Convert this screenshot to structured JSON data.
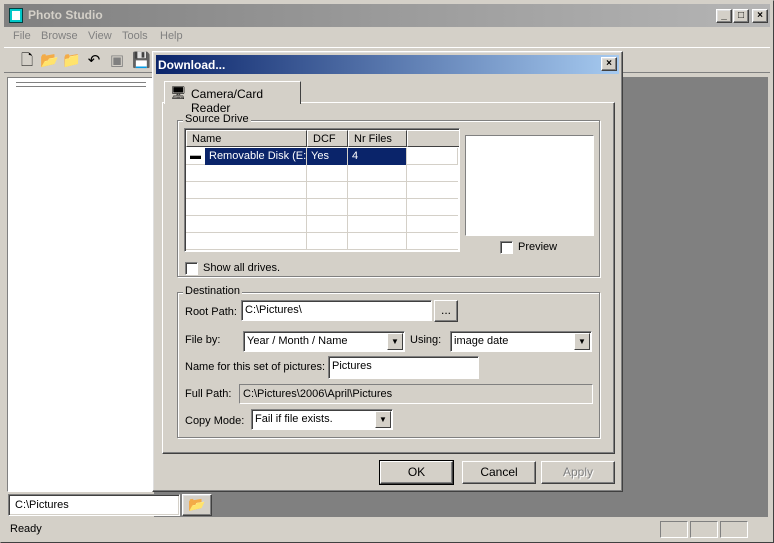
{
  "app": {
    "title": "Photo Studio"
  },
  "menu": [
    "File",
    "Browse",
    "View",
    "Tools",
    "Help"
  ],
  "path_box": {
    "value": "C:\\Pictures"
  },
  "status": {
    "text": "Ready"
  },
  "dialog": {
    "title": "Download...",
    "tab": "Camera/Card Reader",
    "source_drive": {
      "label": "Source Drive",
      "columns": [
        "Name",
        "DCF",
        "Nr Files"
      ],
      "rows": [
        {
          "name": "Removable Disk (E:)",
          "dcf": "Yes",
          "nr_files": "4"
        }
      ],
      "preview_label": "Preview",
      "show_all_label": "Show all drives."
    },
    "destination": {
      "label": "Destination",
      "root_path_label": "Root Path:",
      "root_path_value": "C:\\Pictures\\",
      "browse_label": "...",
      "file_by_label": "File by:",
      "file_by_value": "Year / Month / Name",
      "using_label": "Using:",
      "using_value": "image date",
      "set_name_label": "Name for this set of pictures:",
      "set_name_value": "Pictures",
      "full_path_label": "Full Path:",
      "full_path_value": "C:\\Pictures\\2006\\April\\Pictures",
      "copy_mode_label": "Copy Mode:",
      "copy_mode_value": "Fail if file exists."
    },
    "buttons": {
      "ok": "OK",
      "cancel": "Cancel",
      "apply": "Apply"
    }
  }
}
